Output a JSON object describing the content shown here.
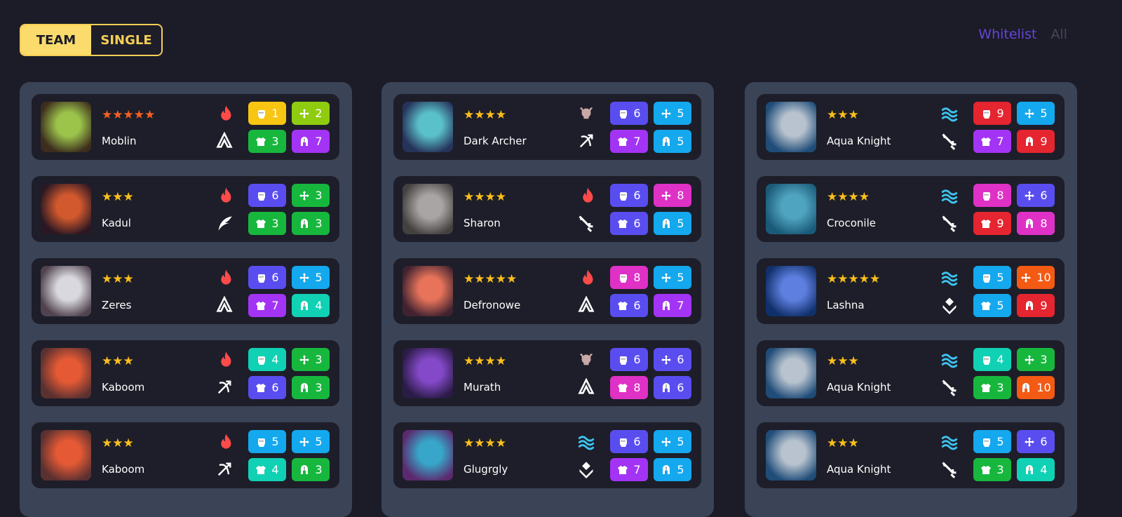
{
  "toggle": {
    "team": "TEAM",
    "single": "SINGLE"
  },
  "filters": {
    "whitelist": "Whitelist",
    "all": "All"
  },
  "columns": [
    {
      "cards": [
        {
          "name": "Moblin",
          "stars": "★★★★★",
          "star_color": "#f45f24",
          "element": "fire-icon",
          "class": "mage-icon",
          "avatar": [
            "#3d2d1d",
            "#9cc44b"
          ],
          "stats": [
            {
              "icon": "fist-icon",
              "value": "1",
              "color": "#f8c512"
            },
            {
              "icon": "crosshair-icon",
              "value": "2",
              "color": "#8fcc10"
            },
            {
              "icon": "armor-icon",
              "value": "3",
              "color": "#17b73e"
            },
            {
              "icon": "helmet-icon",
              "value": "7",
              "color": "#a334f5"
            }
          ]
        },
        {
          "name": "Kadul",
          "stars": "★★★",
          "star_color": "#fbbf1c",
          "element": "fire-icon",
          "class": "wing-icon",
          "avatar": [
            "#2b1723",
            "#d2592e"
          ],
          "stats": [
            {
              "icon": "fist-icon",
              "value": "6",
              "color": "#5a4df0"
            },
            {
              "icon": "crosshair-icon",
              "value": "3",
              "color": "#17b73e"
            },
            {
              "icon": "armor-icon",
              "value": "3",
              "color": "#17b73e"
            },
            {
              "icon": "helmet-icon",
              "value": "3",
              "color": "#17b73e"
            }
          ]
        },
        {
          "name": "Zeres",
          "stars": "★★★",
          "star_color": "#fbbf1c",
          "element": "fire-icon",
          "class": "mage-icon",
          "avatar": [
            "#50434f",
            "#d9d8de"
          ],
          "stats": [
            {
              "icon": "fist-icon",
              "value": "6",
              "color": "#5a4df0"
            },
            {
              "icon": "crosshair-icon",
              "value": "5",
              "color": "#14a8ee"
            },
            {
              "icon": "armor-icon",
              "value": "7",
              "color": "#a334f5"
            },
            {
              "icon": "helmet-icon",
              "value": "4",
              "color": "#11d1b5"
            }
          ]
        },
        {
          "name": "Kaboom",
          "stars": "★★★",
          "star_color": "#fbbf1c",
          "element": "fire-icon",
          "class": "bow-icon",
          "avatar": [
            "#5b3030",
            "#e55a35"
          ],
          "stats": [
            {
              "icon": "fist-icon",
              "value": "4",
              "color": "#11d1b5"
            },
            {
              "icon": "crosshair-icon",
              "value": "3",
              "color": "#17b73e"
            },
            {
              "icon": "armor-icon",
              "value": "6",
              "color": "#5a4df0"
            },
            {
              "icon": "helmet-icon",
              "value": "3",
              "color": "#17b73e"
            }
          ]
        },
        {
          "name": "Kaboom",
          "stars": "★★★",
          "star_color": "#fbbf1c",
          "element": "fire-icon",
          "class": "bow-icon",
          "avatar": [
            "#5b3030",
            "#e55a35"
          ],
          "stats": [
            {
              "icon": "fist-icon",
              "value": "5",
              "color": "#14a8ee"
            },
            {
              "icon": "crosshair-icon",
              "value": "5",
              "color": "#14a8ee"
            },
            {
              "icon": "armor-icon",
              "value": "4",
              "color": "#11d1b5"
            },
            {
              "icon": "helmet-icon",
              "value": "3",
              "color": "#17b73e"
            }
          ]
        }
      ]
    },
    {
      "cards": [
        {
          "name": "Dark Archer",
          "stars": "★★★★",
          "star_color": "#fbbf1c",
          "element": "skull-icon",
          "class": "bow-icon",
          "avatar": [
            "#26335a",
            "#5ac0c9"
          ],
          "stats": [
            {
              "icon": "fist-icon",
              "value": "6",
              "color": "#5a4df0"
            },
            {
              "icon": "crosshair-icon",
              "value": "5",
              "color": "#14a8ee"
            },
            {
              "icon": "armor-icon",
              "value": "7",
              "color": "#a334f5"
            },
            {
              "icon": "helmet-icon",
              "value": "5",
              "color": "#14a8ee"
            }
          ]
        },
        {
          "name": "Sharon",
          "stars": "★★★★",
          "star_color": "#fbbf1c",
          "element": "fire-icon",
          "class": "sword-icon",
          "avatar": [
            "#43413f",
            "#a9a5a4"
          ],
          "stats": [
            {
              "icon": "fist-icon",
              "value": "6",
              "color": "#5a4df0"
            },
            {
              "icon": "crosshair-icon",
              "value": "8",
              "color": "#df31c6"
            },
            {
              "icon": "armor-icon",
              "value": "6",
              "color": "#5a4df0"
            },
            {
              "icon": "helmet-icon",
              "value": "5",
              "color": "#14a8ee"
            }
          ]
        },
        {
          "name": "Defronowe",
          "stars": "★★★★★",
          "star_color": "#fbbf1c",
          "element": "fire-icon",
          "class": "mage-icon",
          "avatar": [
            "#412230",
            "#e6735a"
          ],
          "stats": [
            {
              "icon": "fist-icon",
              "value": "8",
              "color": "#df31c6"
            },
            {
              "icon": "crosshair-icon",
              "value": "5",
              "color": "#14a8ee"
            },
            {
              "icon": "armor-icon",
              "value": "6",
              "color": "#5a4df0"
            },
            {
              "icon": "helmet-icon",
              "value": "7",
              "color": "#a334f5"
            }
          ]
        },
        {
          "name": "Murath",
          "stars": "★★★★",
          "star_color": "#fbbf1c",
          "element": "skull-icon",
          "class": "mage-icon",
          "avatar": [
            "#2a1b47",
            "#8449c8"
          ],
          "stats": [
            {
              "icon": "fist-icon",
              "value": "6",
              "color": "#5a4df0"
            },
            {
              "icon": "crosshair-icon",
              "value": "6",
              "color": "#5a4df0"
            },
            {
              "icon": "armor-icon",
              "value": "8",
              "color": "#df31c6"
            },
            {
              "icon": "helmet-icon",
              "value": "6",
              "color": "#5a4df0"
            }
          ]
        },
        {
          "name": "Glugrgly",
          "stars": "★★★★",
          "star_color": "#fbbf1c",
          "element": "water-icon",
          "class": "support-icon",
          "avatar": [
            "#5b2a6e",
            "#37a6c9"
          ],
          "stats": [
            {
              "icon": "fist-icon",
              "value": "6",
              "color": "#5a4df0"
            },
            {
              "icon": "crosshair-icon",
              "value": "5",
              "color": "#14a8ee"
            },
            {
              "icon": "armor-icon",
              "value": "7",
              "color": "#a334f5"
            },
            {
              "icon": "helmet-icon",
              "value": "5",
              "color": "#14a8ee"
            }
          ]
        }
      ]
    },
    {
      "cards": [
        {
          "name": "Aqua Knight",
          "stars": "★★★",
          "star_color": "#fbbf1c",
          "element": "water-icon",
          "class": "sword-icon",
          "avatar": [
            "#1f4c78",
            "#b8c3cf"
          ],
          "stats": [
            {
              "icon": "fist-icon",
              "value": "9",
              "color": "#e5252f"
            },
            {
              "icon": "crosshair-icon",
              "value": "5",
              "color": "#14a8ee"
            },
            {
              "icon": "armor-icon",
              "value": "7",
              "color": "#a334f5"
            },
            {
              "icon": "helmet-icon",
              "value": "9",
              "color": "#e5252f"
            }
          ]
        },
        {
          "name": "Croconile",
          "stars": "★★★★",
          "star_color": "#fbbf1c",
          "element": "water-icon",
          "class": "sword-icon",
          "avatar": [
            "#1a5a79",
            "#4fa4bf"
          ],
          "stats": [
            {
              "icon": "fist-icon",
              "value": "8",
              "color": "#df31c6"
            },
            {
              "icon": "crosshair-icon",
              "value": "6",
              "color": "#5a4df0"
            },
            {
              "icon": "armor-icon",
              "value": "9",
              "color": "#e5252f"
            },
            {
              "icon": "helmet-icon",
              "value": "8",
              "color": "#df31c6"
            }
          ]
        },
        {
          "name": "Lashna",
          "stars": "★★★★★",
          "star_color": "#fbbf1c",
          "element": "water-icon",
          "class": "support-icon",
          "avatar": [
            "#10306b",
            "#5f7fe0"
          ],
          "stats": [
            {
              "icon": "fist-icon",
              "value": "5",
              "color": "#14a8ee"
            },
            {
              "icon": "crosshair-icon",
              "value": "10",
              "color": "#f35a14"
            },
            {
              "icon": "armor-icon",
              "value": "5",
              "color": "#14a8ee"
            },
            {
              "icon": "helmet-icon",
              "value": "9",
              "color": "#e5252f"
            }
          ]
        },
        {
          "name": "Aqua Knight",
          "stars": "★★★",
          "star_color": "#fbbf1c",
          "element": "water-icon",
          "class": "sword-icon",
          "avatar": [
            "#1f4c78",
            "#b8c3cf"
          ],
          "stats": [
            {
              "icon": "fist-icon",
              "value": "4",
              "color": "#11d1b5"
            },
            {
              "icon": "crosshair-icon",
              "value": "3",
              "color": "#17b73e"
            },
            {
              "icon": "armor-icon",
              "value": "3",
              "color": "#17b73e"
            },
            {
              "icon": "helmet-icon",
              "value": "10",
              "color": "#f35a14"
            }
          ]
        },
        {
          "name": "Aqua Knight",
          "stars": "★★★",
          "star_color": "#fbbf1c",
          "element": "water-icon",
          "class": "sword-icon",
          "avatar": [
            "#1f4c78",
            "#b8c3cf"
          ],
          "stats": [
            {
              "icon": "fist-icon",
              "value": "5",
              "color": "#14a8ee"
            },
            {
              "icon": "crosshair-icon",
              "value": "6",
              "color": "#5a4df0"
            },
            {
              "icon": "armor-icon",
              "value": "3",
              "color": "#17b73e"
            },
            {
              "icon": "helmet-icon",
              "value": "4",
              "color": "#11d1b5"
            }
          ]
        }
      ]
    }
  ]
}
